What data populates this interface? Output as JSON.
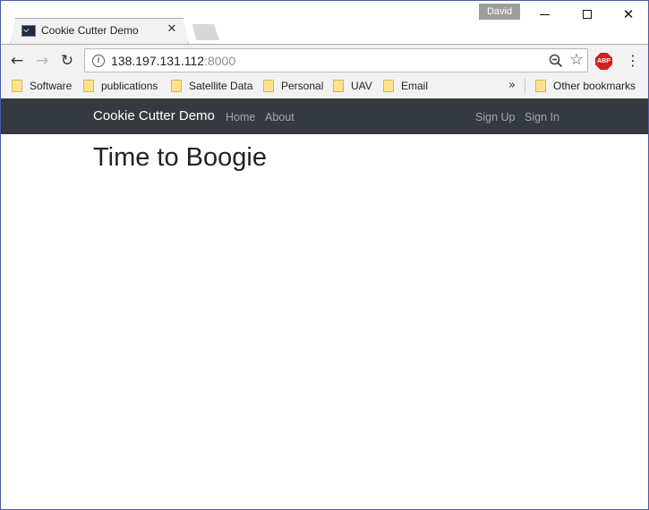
{
  "browser": {
    "tab": {
      "title": "Cookie Cutter Demo",
      "close_glyph": "✕",
      "favicon": "terminal-icon"
    },
    "profile": "David",
    "window_controls": {
      "minimize": "minimize-icon",
      "maximize": "maximize-icon",
      "close": "✕"
    },
    "toolbar": {
      "back_glyph": "←",
      "forward_glyph": "→",
      "reload_glyph": "↻",
      "info_glyph": "i",
      "url_host": "138.197.131.112",
      "url_port": ":8000",
      "star_glyph": "☆",
      "abp_label": "ABP",
      "menu_glyph": "⋮"
    },
    "bookmarks": {
      "items": [
        {
          "label": "Software"
        },
        {
          "label": "publications"
        },
        {
          "label": "Satellite Data"
        },
        {
          "label": "Personal"
        },
        {
          "label": "UAV"
        },
        {
          "label": "Email"
        }
      ],
      "more_glyph": "»",
      "other": "Other bookmarks"
    }
  },
  "site": {
    "brand": "Cookie Cutter Demo",
    "nav_left": [
      "Home",
      "About"
    ],
    "nav_right": [
      "Sign Up",
      "Sign In"
    ],
    "heading": "Time to Boogie"
  },
  "colors": {
    "navbar_bg": "#343a40",
    "nav_link": "#a3a7ab",
    "brand_text": "#ffffff",
    "chrome_bg": "#f2f2f2"
  }
}
